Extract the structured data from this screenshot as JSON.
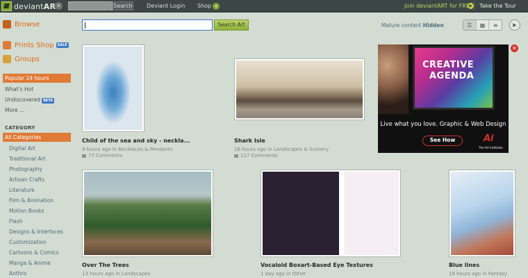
{
  "topbar": {
    "logo_prefix": "deviant",
    "logo_suffix": "ART",
    "search_label": "Search",
    "links": [
      "Deviant Login",
      "Shop"
    ],
    "join": "Join deviantART for FREE",
    "tour": "Take the Tour"
  },
  "sidebar": {
    "browse": "Browse",
    "prints": "Prints Shop",
    "sale": "SALE",
    "groups": "Groups",
    "popular": "Popular 24 hours",
    "whats_hot": "What's Hot",
    "undiscovered": "Undiscovered",
    "beta": "BETA",
    "more": "More ...",
    "category_head": "CATEGORY",
    "all_categories": "All Categories",
    "categories": [
      "Digital Art",
      "Traditional Art",
      "Photography",
      "Artisan Crafts",
      "Literature",
      "Film & Animation",
      "Motion Books",
      "Flash",
      "Designs & Interfaces",
      "Customization",
      "Cartoons & Comics",
      "Manga & Anime",
      "Anthro"
    ]
  },
  "main": {
    "search_button": "Search Art",
    "mature_label": "Mature content",
    "mature_value": "Hidden"
  },
  "artworks": [
    {
      "title": "Child of the sea and sky - neckla...",
      "meta": "9 hours ago in Necklaces & Pendants",
      "comments": "77 Comments"
    },
    {
      "title": "Shark Isle",
      "meta": "16 hours ago in Landscapes & Scenery",
      "comments": "117 Comments"
    },
    {
      "title": "Over The Trees",
      "meta": "13 hours ago in Landscapes",
      "comments": ""
    },
    {
      "title": "Vocaloid Boxart-Based Eye Textures",
      "meta": "1 day ago in Other",
      "comments": ""
    },
    {
      "title": "Blue lines",
      "meta": "19 hours ago in Fantasy",
      "comments": ""
    }
  ],
  "ad": {
    "headline_1": "CREATIVE",
    "headline_2": "AGENDA",
    "tagline": "Live what you love. Graphic & Web Design",
    "cta": "See How",
    "logo": "Ai",
    "logo_sub": "The Art Institutes"
  }
}
